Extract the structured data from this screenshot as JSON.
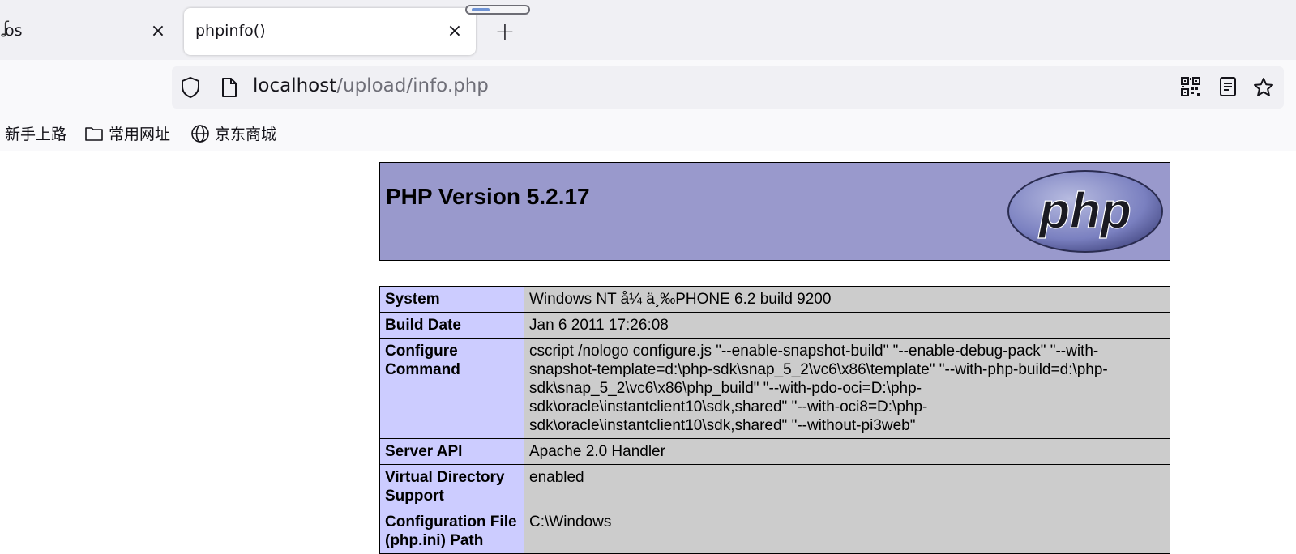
{
  "tabs": [
    {
      "label": "os",
      "close": "×"
    },
    {
      "label": "phpinfo()",
      "close": "×"
    }
  ],
  "new_tab_glyph": "+",
  "nav_edge_glyph": "ʆ",
  "address": {
    "host": "localhost",
    "path": "/upload/info.php"
  },
  "bookmarks": [
    {
      "label": "新手上路"
    },
    {
      "label": "常用网址"
    },
    {
      "label": "京东商城"
    }
  ],
  "php": {
    "version_title": "PHP Version 5.2.17",
    "logo_text": "php",
    "rows": [
      {
        "key": "System",
        "value": "Windows NT å¼ ä¸‰PHONE 6.2 build 9200"
      },
      {
        "key": "Build Date",
        "value": "Jan 6 2011 17:26:08"
      },
      {
        "key": "Configure Command",
        "value": "cscript /nologo configure.js \"--enable-snapshot-build\" \"--enable-debug-pack\" \"--with-snapshot-template=d:\\php-sdk\\snap_5_2\\vc6\\x86\\template\" \"--with-php-build=d:\\php-sdk\\snap_5_2\\vc6\\x86\\php_build\" \"--with-pdo-oci=D:\\php-sdk\\oracle\\instantclient10\\sdk,shared\" \"--with-oci8=D:\\php-sdk\\oracle\\instantclient10\\sdk,shared\" \"--without-pi3web\""
      },
      {
        "key": "Server API",
        "value": "Apache 2.0 Handler"
      },
      {
        "key": "Virtual Directory Support",
        "value": "enabled"
      },
      {
        "key": "Configuration File (php.ini) Path",
        "value": "C:\\Windows"
      }
    ]
  },
  "colors": {
    "php_header": "#9999cc",
    "key_cell": "#ccccff",
    "value_cell": "#cccccc"
  }
}
